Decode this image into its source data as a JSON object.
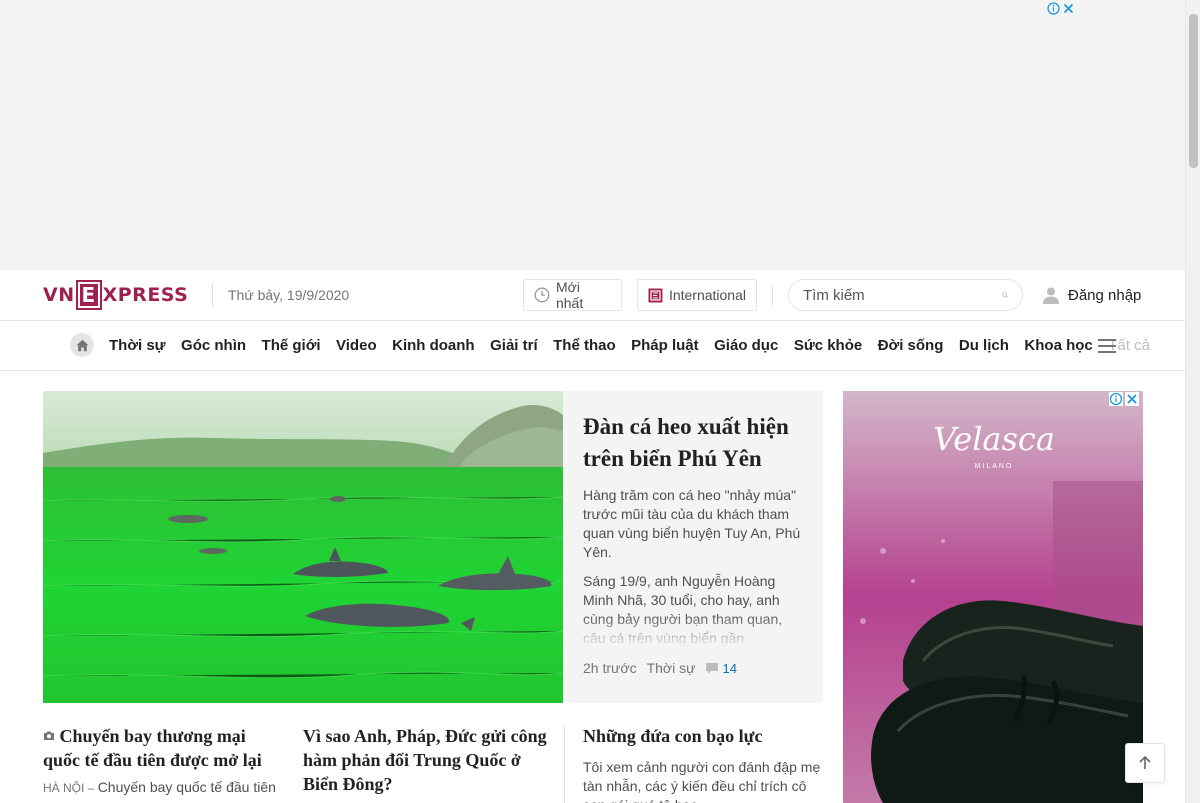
{
  "ad_top": {
    "info_icon": "info-icon",
    "close_icon": "close-icon"
  },
  "header": {
    "logo": {
      "vn": "VN",
      "e": "E",
      "xpress": "XPRESS"
    },
    "date": "Thứ bảy, 19/9/2020",
    "newest_label": "Mới nhất",
    "international_label": "International",
    "search": {
      "placeholder": "Tìm kiếm"
    },
    "login_label": "Đăng nhập"
  },
  "nav": {
    "items": [
      "Thời sự",
      "Góc nhìn",
      "Thế giới",
      "Video",
      "Kinh doanh",
      "Giải trí",
      "Thể thao",
      "Pháp luật",
      "Giáo dục",
      "Sức khỏe",
      "Đời sống",
      "Du lịch",
      "Khoa học"
    ],
    "all_label": "Tất cả"
  },
  "hero": {
    "title": "Đàn cá heo xuất hiện trên biển Phú Yên",
    "description": "Hàng trăm con cá heo \"nhảy múa\" trước mũi tàu của du khách tham quan vùng biển huyện Tuy An, Phú Yên.",
    "body": "Sáng 19/9, anh Nguyễn Hoàng Minh Nhã, 30 tuổi, cho hay, anh cùng bảy người bạn tham quan, câu cá trên vùng biển gần",
    "time": "2h trước",
    "category": "Thời sự",
    "comments": "14"
  },
  "ad_side": {
    "brand": "Velasca",
    "sub": "MILANO"
  },
  "stories": [
    {
      "title": "Chuyến bay thương mại quốc tế đầu tiên được mở lại",
      "location": "Hà Nội",
      "excerpt": "Chuyến bay quốc tế đầu tiên"
    },
    {
      "title": "Vì sao Anh, Pháp, Đức gửi công hàm phản đối Trung Quốc ở Biển Đông?"
    },
    {
      "title": "Những đứa con bạo lực",
      "excerpt": "Tôi xem cảnh người con đánh đập mẹ tàn nhẫn, các ý kiến đều chỉ trích cô con gái quá tệ bạc"
    }
  ],
  "colors": {
    "brand": "#9f224e",
    "accent_blue": "#076db6",
    "ad_bg": "#f4f4f4"
  }
}
